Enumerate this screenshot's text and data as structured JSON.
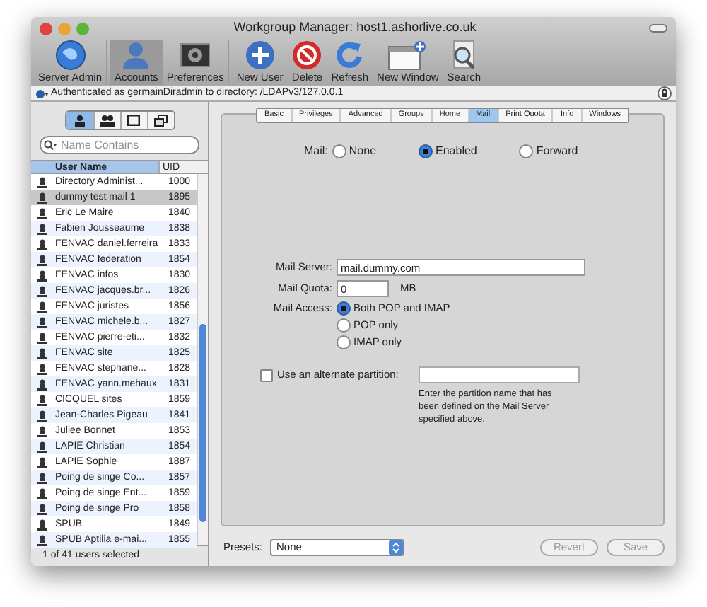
{
  "window": {
    "title": "Workgroup Manager: host1.ashorlive.co.uk"
  },
  "toolbar": [
    {
      "label": "Server Admin",
      "kind": "globe",
      "selected": false
    },
    {
      "label": "Accounts",
      "kind": "person",
      "selected": true
    },
    {
      "label": "Preferences",
      "kind": "prefs",
      "selected": false
    },
    {
      "label": "New User",
      "kind": "plus",
      "selected": false
    },
    {
      "label": "Delete",
      "kind": "stop",
      "selected": false
    },
    {
      "label": "Refresh",
      "kind": "refresh",
      "selected": false
    },
    {
      "label": "New Window",
      "kind": "window",
      "selected": false
    },
    {
      "label": "Search",
      "kind": "search",
      "selected": false
    }
  ],
  "auth_bar": {
    "text": "Authenticated as germainDiradmin to directory: /LDAPv3/127.0.0.1"
  },
  "account_types": [
    {
      "kind": "user",
      "selected": true
    },
    {
      "kind": "group",
      "selected": false
    },
    {
      "kind": "computer",
      "selected": false
    },
    {
      "kind": "computer_group",
      "selected": false
    }
  ],
  "search": {
    "placeholder": "Name Contains"
  },
  "user_table": {
    "columns": [
      "User Name",
      "UID"
    ],
    "rows": [
      {
        "name": "Directory Administ...",
        "uid": "1000",
        "selected": false
      },
      {
        "name": "dummy test mail 1",
        "uid": "1895",
        "selected": true
      },
      {
        "name": "Eric Le Maire",
        "uid": "1840",
        "selected": false
      },
      {
        "name": "Fabien Jousseaume",
        "uid": "1838",
        "selected": false
      },
      {
        "name": "FENVAC daniel.ferreira",
        "uid": "1833",
        "selected": false
      },
      {
        "name": "FENVAC federation",
        "uid": "1854",
        "selected": false
      },
      {
        "name": "FENVAC infos",
        "uid": "1830",
        "selected": false
      },
      {
        "name": "FENVAC jacques.br...",
        "uid": "1826",
        "selected": false
      },
      {
        "name": "FENVAC juristes",
        "uid": "1856",
        "selected": false
      },
      {
        "name": "FENVAC michele.b...",
        "uid": "1827",
        "selected": false
      },
      {
        "name": "FENVAC pierre-eti...",
        "uid": "1832",
        "selected": false
      },
      {
        "name": "FENVAC site",
        "uid": "1825",
        "selected": false
      },
      {
        "name": "FENVAC stephane...",
        "uid": "1828",
        "selected": false
      },
      {
        "name": "FENVAC yann.mehaux",
        "uid": "1831",
        "selected": false
      },
      {
        "name": "CICQUEL sites",
        "uid": "1859",
        "selected": false
      },
      {
        "name": "Jean-Charles Pigeau",
        "uid": "1841",
        "selected": false
      },
      {
        "name": "Juliee Bonnet",
        "uid": "1853",
        "selected": false
      },
      {
        "name": "LAPIE Christian",
        "uid": "1854",
        "selected": false
      },
      {
        "name": "LAPIE Sophie",
        "uid": "1887",
        "selected": false
      },
      {
        "name": "Poing de singe Co...",
        "uid": "1857",
        "selected": false
      },
      {
        "name": "Poing de singe Ent...",
        "uid": "1859",
        "selected": false
      },
      {
        "name": "Poing de singe Pro",
        "uid": "1858",
        "selected": false
      },
      {
        "name": "SPUB",
        "uid": "1849",
        "selected": false
      },
      {
        "name": "SPUB Aptilia e-mai...",
        "uid": "1855",
        "selected": false
      }
    ]
  },
  "list_status": "1 of 41 users selected",
  "tabs": [
    {
      "label": "Basic",
      "selected": false
    },
    {
      "label": "Privileges",
      "selected": false
    },
    {
      "label": "Advanced",
      "selected": false
    },
    {
      "label": "Groups",
      "selected": false
    },
    {
      "label": "Home",
      "selected": false
    },
    {
      "label": "Mail",
      "selected": true
    },
    {
      "label": "Print Quota",
      "selected": false
    },
    {
      "label": "Info",
      "selected": false
    },
    {
      "label": "Windows",
      "selected": false
    }
  ],
  "mail": {
    "label": "Mail:",
    "options": [
      {
        "label": "None",
        "selected": false
      },
      {
        "label": "Enabled",
        "selected": true
      },
      {
        "label": "Forward",
        "selected": false
      }
    ]
  },
  "mail_server": {
    "label": "Mail Server:",
    "value": "mail.dummy.com"
  },
  "mail_quota": {
    "label": "Mail Quota:",
    "value": "0",
    "unit": "MB"
  },
  "mail_access": {
    "label": "Mail Access:",
    "options": [
      {
        "label": "Both POP and IMAP",
        "selected": true
      },
      {
        "label": "POP only",
        "selected": false
      },
      {
        "label": "IMAP only",
        "selected": false
      }
    ]
  },
  "alternate_partition": {
    "label": "Use an alternate partition:",
    "checked": false,
    "note": "Enter the partition name that has been defined on the Mail Server specified above."
  },
  "presets": {
    "label": "Presets:",
    "value": "None"
  },
  "buttons": [
    {
      "label": "Revert",
      "disabled": true
    },
    {
      "label": "Save",
      "disabled": true
    }
  ]
}
